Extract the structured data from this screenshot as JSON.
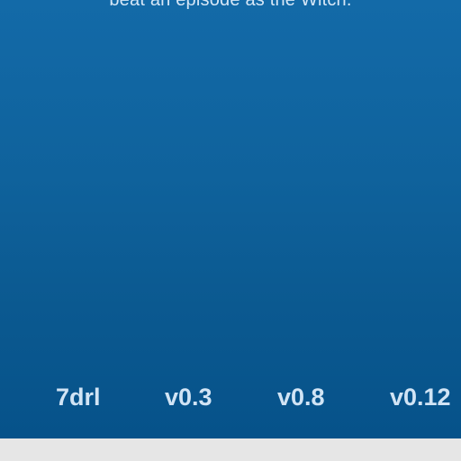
{
  "hero": {
    "caption": "beat an episode as the Witch."
  },
  "timeline": {
    "versions": [
      "7drl",
      "v0.3",
      "v0.8",
      "v0.12"
    ]
  },
  "colors": {
    "panel_top": "#136aa8",
    "panel_bottom": "#06528a",
    "text_light": "#d1e4f5",
    "footer_bg": "#e6e6e6"
  }
}
